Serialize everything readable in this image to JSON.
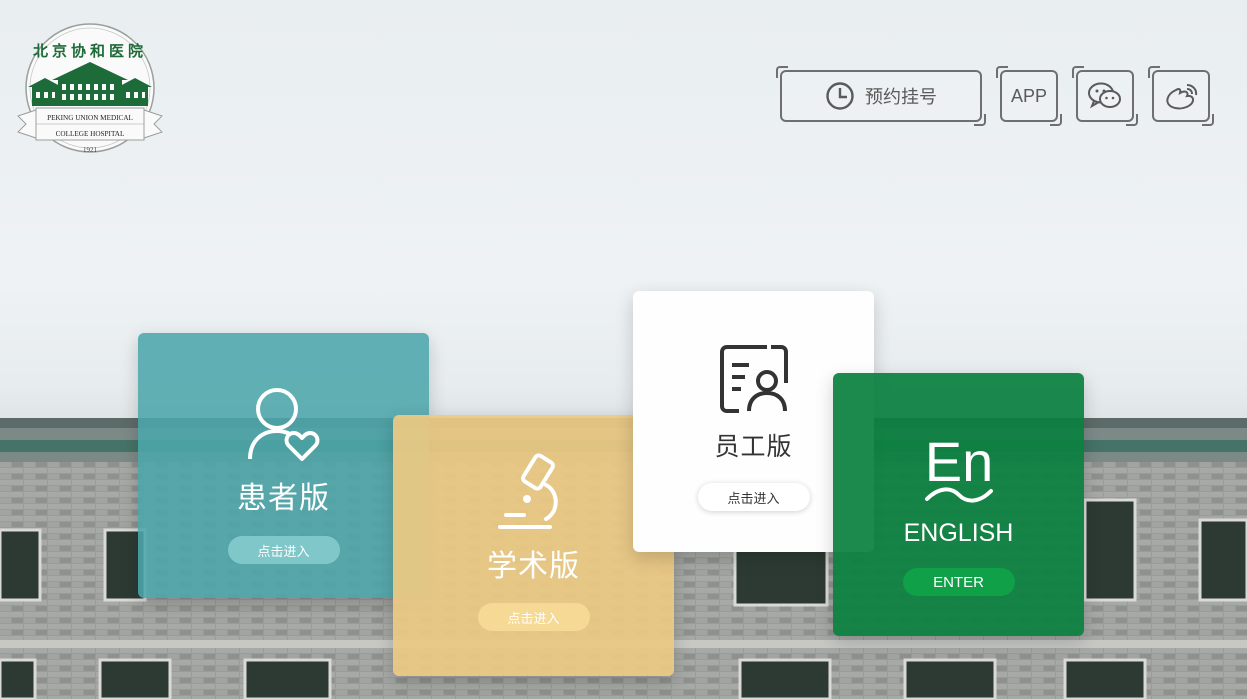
{
  "logo": {
    "name_cn": "北京协和医院",
    "name_en_line1": "PEKING UNION MEDICAL",
    "name_en_line2": "COLLEGE HOSPITAL",
    "year": "1921"
  },
  "topnav": {
    "appointment_label": "预约挂号",
    "app_label": "APP",
    "wechat_icon": "wechat-icon",
    "weibo_icon": "weibo-icon"
  },
  "cards": {
    "patient": {
      "title": "患者版",
      "button": "点击进入",
      "icon": "user-heart-icon"
    },
    "academic": {
      "title": "学术版",
      "button": "点击进入",
      "icon": "microscope-icon"
    },
    "staff": {
      "title": "员工版",
      "button": "点击进入",
      "icon": "staff-id-card-icon"
    },
    "english": {
      "title": "ENGLISH",
      "button": "ENTER",
      "icon": "en-icon",
      "icon_text": "En"
    }
  },
  "colors": {
    "patient": "#4ca6ab",
    "academic": "#ecc983",
    "staff": "#ffffff",
    "english": "#0b8040",
    "logo_green": "#1e6b3a"
  }
}
